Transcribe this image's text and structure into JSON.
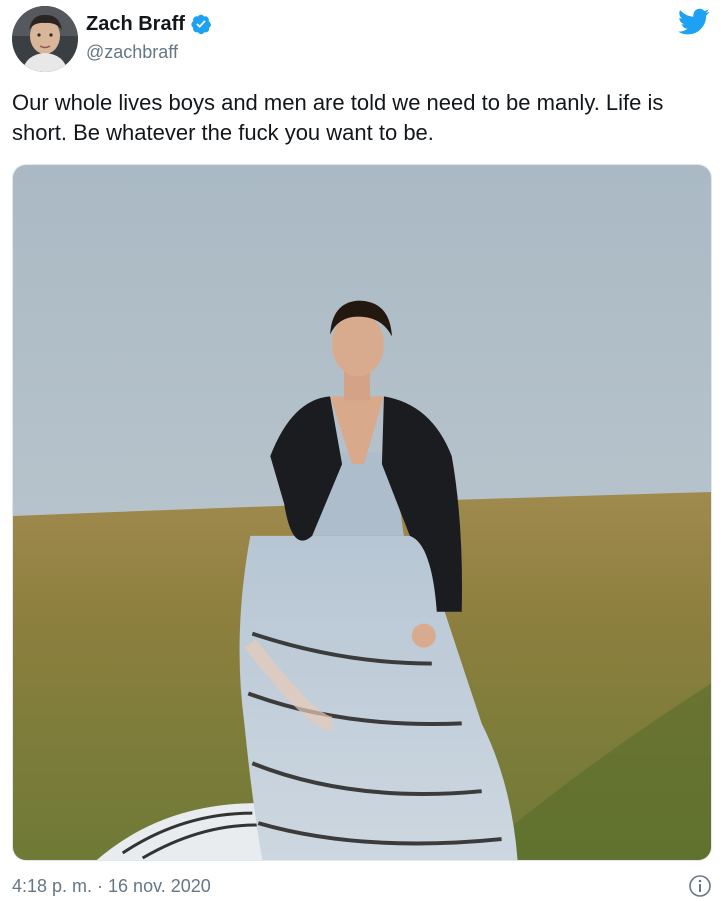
{
  "author": {
    "display_name": "Zach Braff",
    "handle": "@zachbraff",
    "verified": true,
    "avatar_icon": "user-avatar"
  },
  "tweet": {
    "text": "Our whole lives boys and men are told we need to be manly.  Life is short. Be whatever the fuck you want to be.",
    "timestamp": "4:18 p. m. · 16 nov. 2020"
  },
  "media": {
    "type": "photo"
  },
  "icons": {
    "brand": "twitter-bird-icon",
    "verified": "verified-badge-icon",
    "info": "info-icon"
  },
  "colors": {
    "twitter_blue": "#1da1f2",
    "text_primary": "#14171a",
    "text_secondary": "#657786"
  }
}
